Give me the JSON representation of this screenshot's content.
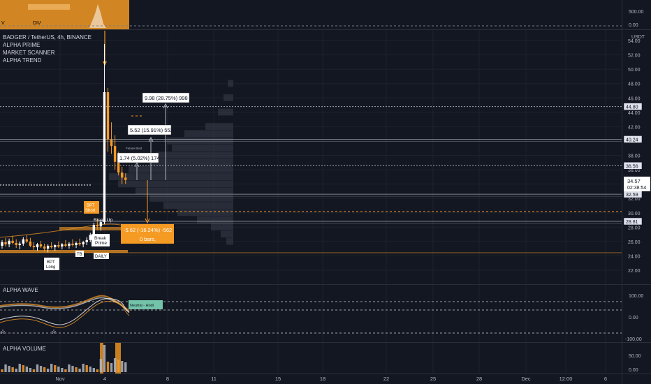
{
  "header": {
    "symbol_line": "BADGER / TetherUS, 4h, BINANCE",
    "indicators": [
      "ALPHA PRIME",
      "MARKET SCANNER",
      "ALPHA TREND"
    ],
    "currency": "USDT",
    "top_pane_labels": [
      "V",
      "DIV"
    ],
    "top_pane_axis": [
      "500.00",
      "0.00"
    ]
  },
  "panes": {
    "wave_title": "ALPHA WAVE",
    "wave_axis": [
      "100.00",
      "0.00",
      "-100.00"
    ],
    "wave_tag": "Neutral - Hodl",
    "volume_title": "ALPHA VOLUME",
    "volume_axis": [
      "50.00",
      "0.00"
    ]
  },
  "price": {
    "current": "34.57",
    "countdown": "02:38:54",
    "current_color": "#ffffff"
  },
  "levels": [
    {
      "value": "44.80"
    },
    {
      "value": "40.24"
    },
    {
      "value": "36.56"
    },
    {
      "value": "32.59"
    },
    {
      "value": "28.81"
    }
  ],
  "annotations": {
    "target_3": "9.98 (28.75%) 998",
    "target_2": "5.52 (15.91%) 552",
    "target_1": "1.74 (5.02%) 174",
    "stop": "-5.62 (-16.24%) -562",
    "stop_bars": "0 bars,",
    "small_label": "Future Best",
    "signals": [
      "BPT Short",
      "BPT Long",
      "Break Prime",
      "Break Up",
      "TB",
      "DAILY"
    ]
  },
  "chart_data": {
    "type": "candlestick",
    "y_axis_ticks": [
      "54.00",
      "52.00",
      "50.00",
      "48.00",
      "46.00",
      "44.00",
      "42.00",
      "40.00",
      "38.00",
      "36.00",
      "34.00",
      "32.00",
      "30.00",
      "28.00",
      "26.00",
      "24.00",
      "22.00"
    ],
    "x_axis_ticks": [
      "Nov",
      "4",
      "8",
      "11",
      "15",
      "18",
      "22",
      "25",
      "28",
      "Dec",
      "12:00",
      "6"
    ],
    "ylim": [
      21,
      55
    ],
    "ohlc": [
      {
        "o": 25.4,
        "h": 26.2,
        "l": 25.0,
        "c": 25.9
      },
      {
        "o": 25.9,
        "h": 26.5,
        "l": 25.3,
        "c": 25.6
      },
      {
        "o": 25.6,
        "h": 26.4,
        "l": 25.2,
        "c": 26.1
      },
      {
        "o": 26.1,
        "h": 26.8,
        "l": 25.6,
        "c": 25.8
      },
      {
        "o": 25.8,
        "h": 26.3,
        "l": 25.1,
        "c": 25.5
      },
      {
        "o": 25.5,
        "h": 26.0,
        "l": 24.9,
        "c": 25.7
      },
      {
        "o": 25.7,
        "h": 26.6,
        "l": 25.4,
        "c": 26.3
      },
      {
        "o": 26.3,
        "h": 26.9,
        "l": 25.8,
        "c": 26.0
      },
      {
        "o": 26.0,
        "h": 26.5,
        "l": 25.2,
        "c": 25.4
      },
      {
        "o": 25.4,
        "h": 25.9,
        "l": 24.8,
        "c": 25.2
      },
      {
        "o": 25.2,
        "h": 25.8,
        "l": 24.7,
        "c": 25.6
      },
      {
        "o": 25.6,
        "h": 26.1,
        "l": 25.1,
        "c": 25.3
      },
      {
        "o": 25.3,
        "h": 25.7,
        "l": 24.6,
        "c": 25.0
      },
      {
        "o": 25.0,
        "h": 25.6,
        "l": 24.5,
        "c": 25.4
      },
      {
        "o": 25.4,
        "h": 25.9,
        "l": 25.0,
        "c": 25.2
      },
      {
        "o": 25.2,
        "h": 25.6,
        "l": 24.7,
        "c": 25.5
      },
      {
        "o": 25.5,
        "h": 26.0,
        "l": 25.1,
        "c": 25.3
      },
      {
        "o": 25.3,
        "h": 25.8,
        "l": 24.9,
        "c": 25.6
      },
      {
        "o": 25.6,
        "h": 26.2,
        "l": 25.2,
        "c": 25.4
      },
      {
        "o": 25.4,
        "h": 25.9,
        "l": 25.0,
        "c": 25.7
      },
      {
        "o": 25.7,
        "h": 26.3,
        "l": 25.3,
        "c": 25.5
      },
      {
        "o": 25.5,
        "h": 26.0,
        "l": 25.1,
        "c": 25.8
      },
      {
        "o": 25.8,
        "h": 26.4,
        "l": 25.4,
        "c": 25.6
      },
      {
        "o": 25.6,
        "h": 26.1,
        "l": 25.2,
        "c": 25.9
      },
      {
        "o": 25.9,
        "h": 26.6,
        "l": 25.5,
        "c": 26.2
      },
      {
        "o": 26.2,
        "h": 27.2,
        "l": 25.9,
        "c": 26.9
      },
      {
        "o": 26.9,
        "h": 28.6,
        "l": 26.5,
        "c": 28.3
      },
      {
        "o": 28.3,
        "h": 29.2,
        "l": 27.6,
        "c": 28.1
      },
      {
        "o": 28.1,
        "h": 29.0,
        "l": 27.5,
        "c": 28.7
      },
      {
        "o": 28.7,
        "h": 53.5,
        "l": 28.4,
        "c": 46.8
      },
      {
        "o": 46.8,
        "h": 47.4,
        "l": 38.5,
        "c": 40.2
      },
      {
        "o": 40.2,
        "h": 42.6,
        "l": 38.2,
        "c": 39.3
      },
      {
        "o": 39.3,
        "h": 40.8,
        "l": 36.0,
        "c": 37.1
      },
      {
        "o": 37.1,
        "h": 38.5,
        "l": 35.2,
        "c": 35.6
      },
      {
        "o": 35.6,
        "h": 36.4,
        "l": 34.0,
        "c": 34.9
      },
      {
        "o": 34.9,
        "h": 35.5,
        "l": 34.0,
        "c": 34.57
      }
    ]
  }
}
